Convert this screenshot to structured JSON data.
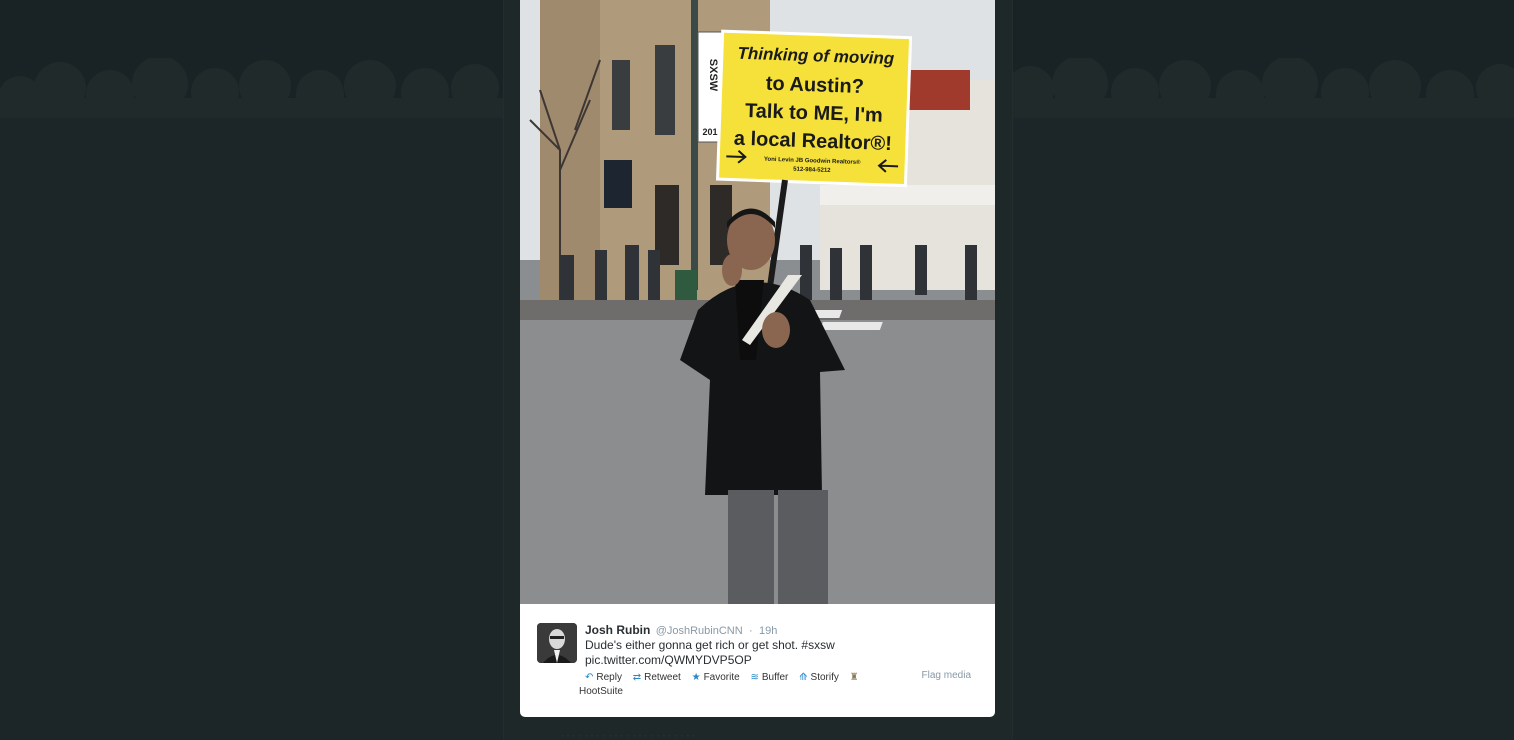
{
  "photo": {
    "sign_lines": [
      "Thinking of moving",
      "to Austin?",
      "Talk to ME, I'm",
      "a local Realtor®!"
    ],
    "sign_small": [
      "Yoni Levin JB Goodwin Realtors®",
      "512-984-5212"
    ],
    "banner_text": "SXSW",
    "banner_sub": "201"
  },
  "tweet": {
    "fullname": "Josh Rubin",
    "username": "@JoshRubinCNN",
    "dot": "·",
    "time": "19h",
    "text_line1": "Dude's either gonna get rich or get shot.  #sxsw",
    "text_line2": "pic.twitter.com/QWMYDVP5OP"
  },
  "actions": {
    "reply": "Reply",
    "retweet": "Retweet",
    "favorite": "Favorite",
    "buffer": "Buffer",
    "storify": "Storify",
    "hootsuite": "HootSuite",
    "flag_media": "Flag media"
  },
  "icons": {
    "reply": "reply-icon",
    "retweet": "retweet-icon",
    "favorite": "star-icon",
    "buffer": "buffer-icon",
    "storify": "storify-icon",
    "hootsuite": "hootsuite-owl-icon"
  },
  "colors": {
    "page_bg": "#1c2527",
    "card_bg": "#ffffff",
    "action_blue": "#2a86c7",
    "sign_yellow": "#f5e13a"
  }
}
